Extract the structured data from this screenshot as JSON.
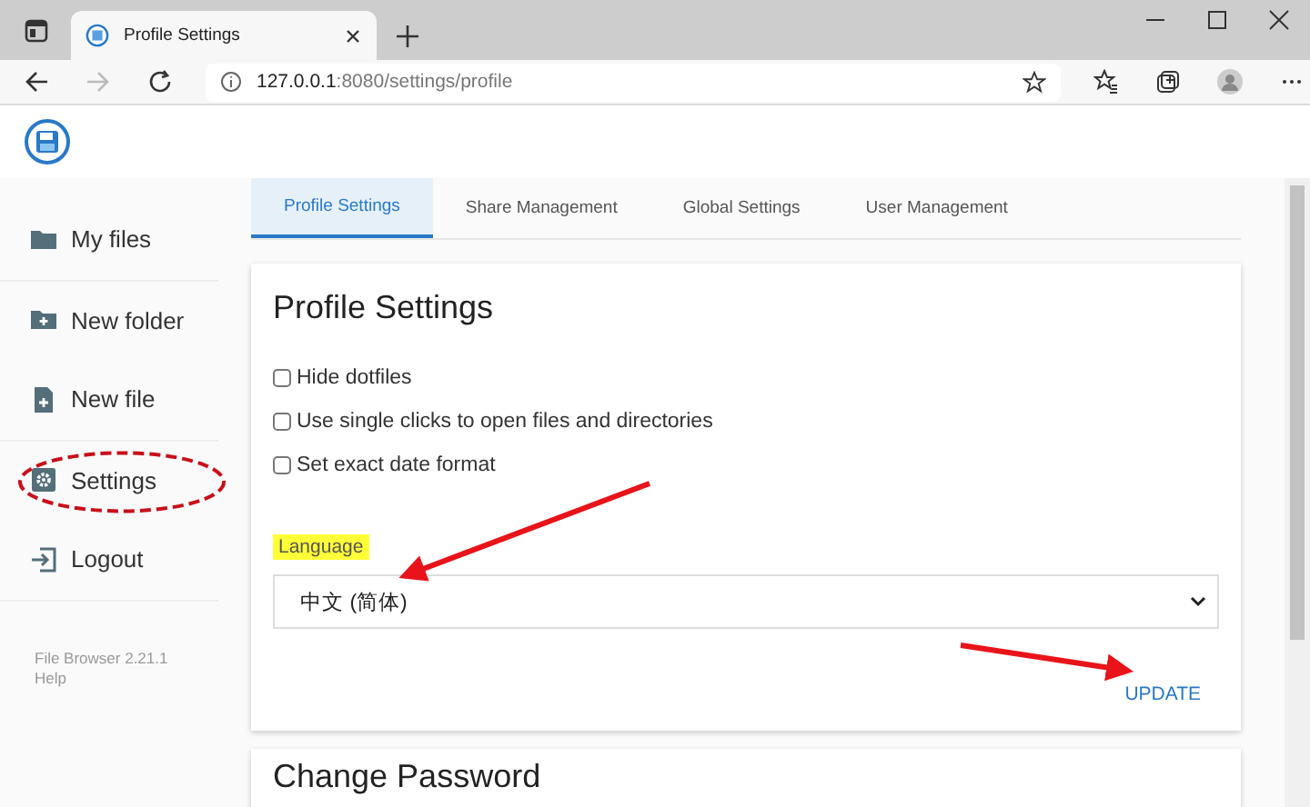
{
  "browser": {
    "tab_title": "Profile Settings",
    "url_host": "127.0.0.1",
    "url_rest": ":8080/settings/profile"
  },
  "sidebar": {
    "items": [
      {
        "label": "My files",
        "kind": "folder",
        "circled": false
      },
      {
        "label": "New folder",
        "kind": "folder-plus",
        "circled": false
      },
      {
        "label": "New file",
        "kind": "file-plus",
        "circled": false
      },
      {
        "label": "Settings",
        "kind": "gear",
        "circled": true
      },
      {
        "label": "Logout",
        "kind": "logout",
        "circled": false
      }
    ],
    "footer": [
      "File Browser 2.21.1",
      "Help"
    ]
  },
  "tabs": [
    {
      "label": "Profile Settings",
      "selected": true
    },
    {
      "label": "Share Management",
      "selected": false
    },
    {
      "label": "Global Settings",
      "selected": false
    },
    {
      "label": "User Management",
      "selected": false
    }
  ],
  "card": {
    "title": "Profile Settings",
    "options": [
      {
        "label": "Hide dotfiles",
        "checked": false
      },
      {
        "label": "Use single clicks to open files and directories",
        "checked": false
      },
      {
        "label": "Set exact date format",
        "checked": false
      }
    ],
    "language": {
      "label": "Language",
      "highlighted": true,
      "value": "中文 (简体)"
    },
    "button": "UPDATE"
  },
  "next_card": {
    "title": "Change Password"
  }
}
